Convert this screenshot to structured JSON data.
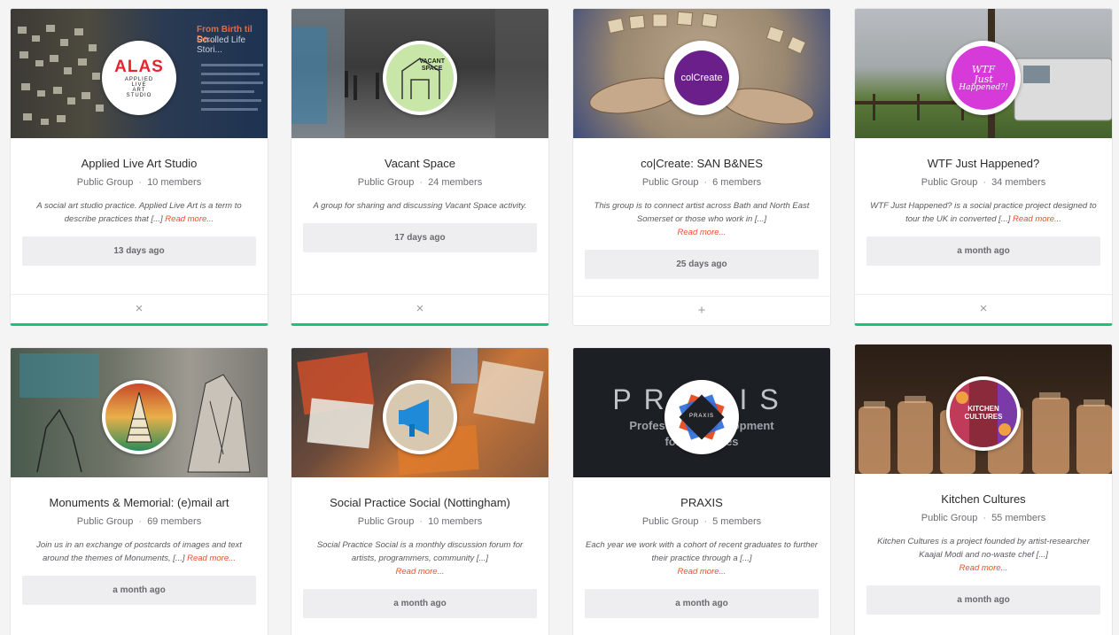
{
  "groups": [
    {
      "title": "Applied Live Art Studio",
      "type": "Public Group",
      "members": "10 members",
      "description": "A social art studio practice. Applied Live Art is a term to describe practices that [...]",
      "read_more": "Read more...",
      "activity": "13 days ago",
      "action_icon": "×",
      "logo_lines": [
        "ALAS",
        "APPLIED",
        "LIVE",
        "ART",
        "STUDIO"
      ]
    },
    {
      "title": "Vacant Space",
      "type": "Public Group",
      "members": "24 members",
      "description": "A group for sharing and discussing Vacant Space activity.",
      "read_more": "",
      "activity": "17 days ago",
      "action_icon": "×",
      "logo_lines": [
        "VACANT",
        "SPACE"
      ]
    },
    {
      "title": "co|Create: SAN B&NES",
      "type": "Public Group",
      "members": "6 members",
      "description": "This group is to connect artist across Bath and North East Somerset or those who work in [...]",
      "read_more": "Read more...",
      "activity": "25 days ago",
      "action_icon": "+",
      "logo_lines": [
        "colCreate"
      ]
    },
    {
      "title": "WTF Just Happened?",
      "type": "Public Group",
      "members": "34 members",
      "description": "WTF Just Happened? is a social practice project designed to tour the UK in converted [...]",
      "read_more": "Read more...",
      "activity": "a month ago",
      "action_icon": "×",
      "logo_lines": [
        "WTF",
        "Just",
        "Happened?!"
      ]
    },
    {
      "title": "Monuments & Memorial: (e)mail art",
      "type": "Public Group",
      "members": "69 members",
      "description": "Join us in an exchange of postcards of images and text around the themes of Monuments, [...]",
      "read_more": "Read more...",
      "activity": "a month ago"
    },
    {
      "title": "Social Practice Social (Nottingham)",
      "type": "Public Group",
      "members": "10 members",
      "description": "Social Practice Social is a monthly discussion forum for artists, programmers, community [...]",
      "read_more": "Read more...",
      "activity": "a month ago"
    },
    {
      "title": "PRAXIS",
      "type": "Public Group",
      "members": "5 members",
      "description": "Each year we work with a cohort of recent graduates to further their practice through a [...]",
      "read_more": "Read more...",
      "activity": "a month ago",
      "cover_lines": [
        "PRAXIS",
        "Professional Development",
        "for graduates"
      ],
      "logo_lines": [
        "PRAXIS"
      ]
    },
    {
      "title": "Kitchen Cultures",
      "type": "Public Group",
      "members": "55 members",
      "description": "Kitchen Cultures is a project founded by artist-researcher Kaajal Modi and no-waste chef [...]",
      "read_more": "Read more...",
      "activity": "a month ago",
      "logo_lines": [
        "KITCHEN",
        "CULTURES"
      ]
    }
  ],
  "meta_separator": "·",
  "cover_text_alas": [
    "From Birth til De...",
    "Scrolled Life Stori..."
  ],
  "cover_text_cocreate": "CREATE",
  "colors": {
    "joined_accent": "#1fc07b",
    "read_more": "#e8502b"
  }
}
